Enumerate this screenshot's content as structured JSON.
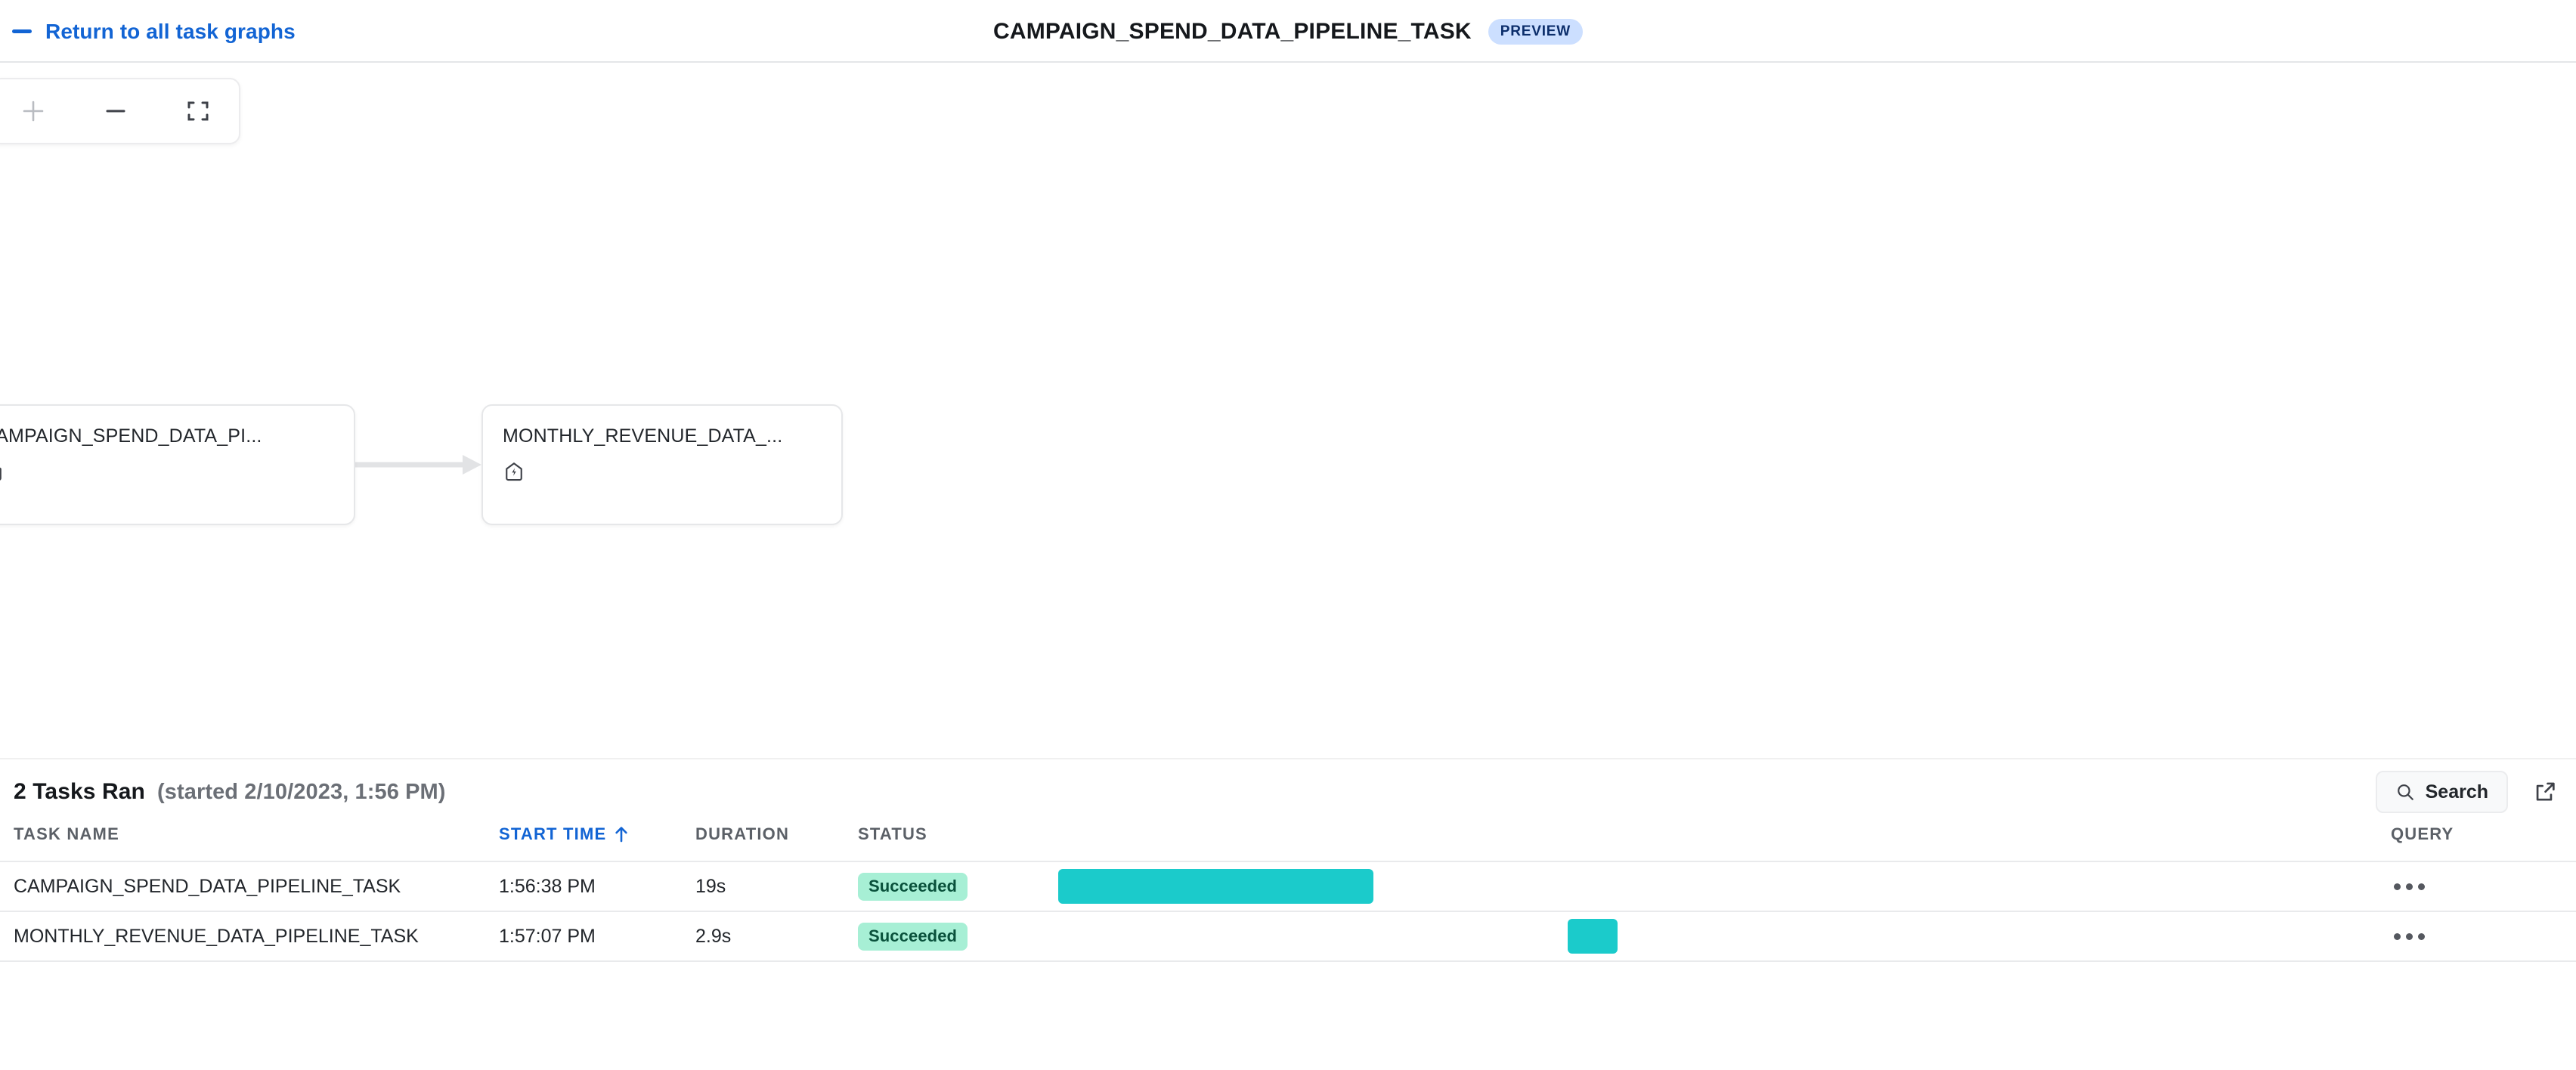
{
  "header": {
    "back_label": "Return to all task graphs",
    "title": "CAMPAIGN_SPEND_DATA_PIPELINE_TASK",
    "preview_badge": "PREVIEW",
    "back_icon": "long-dash-back-icon"
  },
  "canvas": {
    "zoom_controls": [
      {
        "name": "zoom-in-button",
        "icon": "plus-icon"
      },
      {
        "name": "zoom-out-button",
        "icon": "minus-icon"
      },
      {
        "name": "fit-to-screen-button",
        "icon": "fullscreen-brackets-icon"
      }
    ],
    "nodes": [
      {
        "label": "CAMPAIGN_SPEND_DATA_PI...",
        "icon": "task-lightning-icon"
      },
      {
        "label": "MONTHLY_REVENUE_DATA_...",
        "icon": "task-lightning-icon"
      }
    ],
    "edge": {
      "from": "CAMPAIGN_SPEND_DATA_PI...",
      "to": "MONTHLY_REVENUE_DATA_...",
      "color": "#e2e3e5"
    }
  },
  "runs": {
    "count_label": "2 Tasks Ran",
    "started_label": "(started 2/10/2023, 1:56 PM)",
    "search_label": "Search",
    "search_icon": "search-icon",
    "external_link_icon": "external-link-icon",
    "columns": [
      {
        "label": "TASK NAME",
        "sorted": false
      },
      {
        "label": "START TIME",
        "sorted": true,
        "sort_direction": "asc"
      },
      {
        "label": "DURATION",
        "sorted": false
      },
      {
        "label": "STATUS",
        "sorted": false
      },
      {
        "label": "",
        "sorted": false
      },
      {
        "label": "QUERY",
        "sorted": false
      }
    ],
    "rows": [
      {
        "task_name": "CAMPAIGN_SPEND_DATA_PIPELINE_TASK",
        "start_time": "1:56:38 PM",
        "duration": "19s",
        "status": "Succeeded",
        "bar_left_pct": 0.0,
        "bar_width_pct": 23.9,
        "query_menu_icon": "kebab-menu-icon"
      },
      {
        "task_name": "MONTHLY_REVENUE_DATA_PIPELINE_TASK",
        "start_time": "1:57:07 PM",
        "duration": "2.9s",
        "status": "Succeeded",
        "bar_left_pct": 38.6,
        "bar_width_pct": 3.8,
        "query_menu_icon": "kebab-menu-icon"
      }
    ]
  },
  "colors": {
    "link_blue": "#1264d4",
    "gantt_bar": "#1bcbcb",
    "status_bg": "#a7efd5",
    "status_text": "#09513b",
    "badge_bg": "#ccdfff",
    "badge_text": "#0c2e6b"
  }
}
